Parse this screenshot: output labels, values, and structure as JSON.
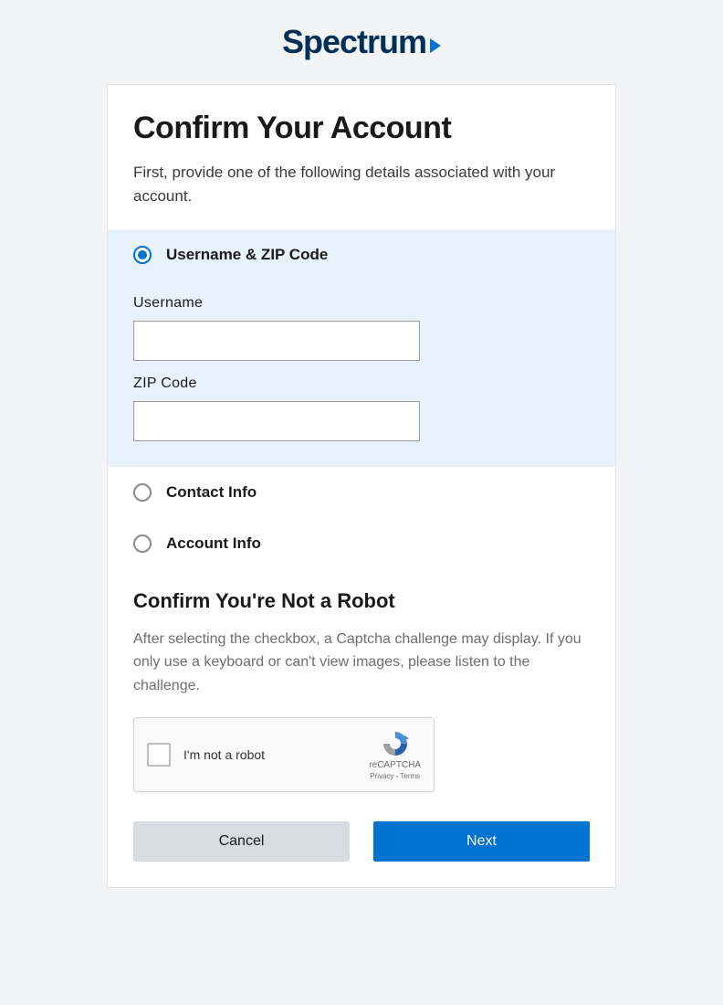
{
  "logo": {
    "text": "Spectrum"
  },
  "header": {
    "title": "Confirm Your Account",
    "subtitle": "First, provide one of the following details associated with your account."
  },
  "options": {
    "username_zip": {
      "label": "Username & ZIP Code",
      "fields": {
        "username_label": "Username",
        "zip_label": "ZIP Code"
      }
    },
    "contact": {
      "label": "Contact Info"
    },
    "account": {
      "label": "Account Info"
    }
  },
  "captcha": {
    "title": "Confirm You're Not a Robot",
    "text": "After selecting the checkbox, a Captcha challenge may display. If you only use a keyboard or can't view images, please listen to the challenge.",
    "checkbox_label": "I'm not a robot",
    "brand": "reCAPTCHA",
    "links": "Privacy - Terms"
  },
  "buttons": {
    "cancel": "Cancel",
    "next": "Next"
  }
}
